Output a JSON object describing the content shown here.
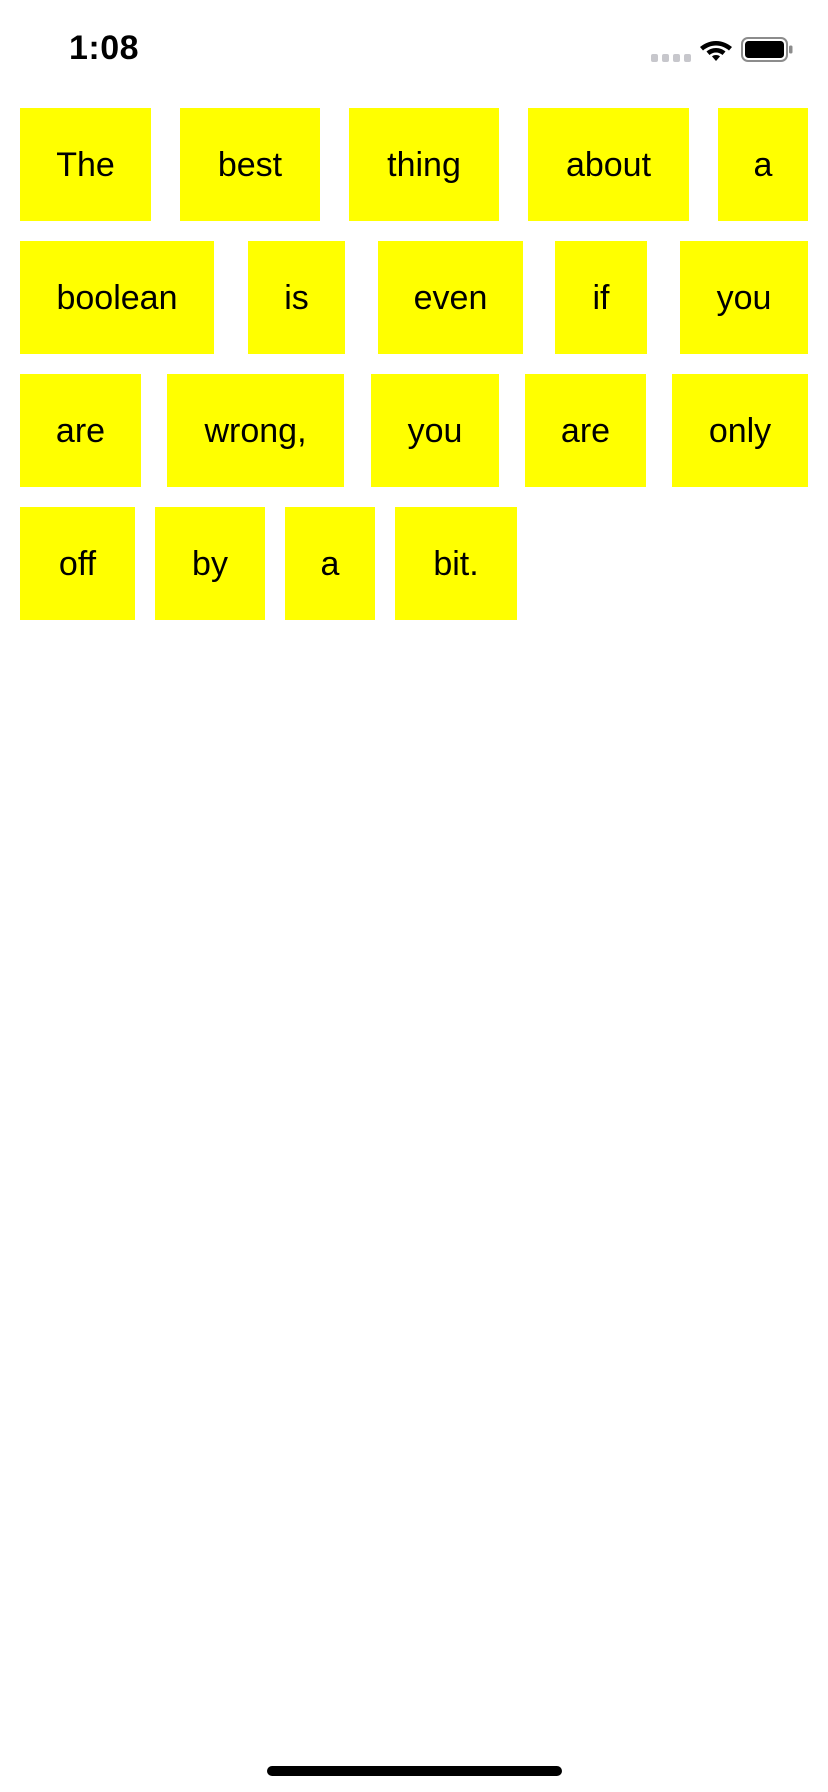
{
  "status_bar": {
    "time": "1:08",
    "icons": [
      "cellular-signal-icon",
      "wifi-icon",
      "battery-icon"
    ]
  },
  "colors": {
    "tile_background": "#ffff00",
    "text": "#000000",
    "page_background": "#ffffff"
  },
  "words": [
    "The",
    "best",
    "thing",
    "about",
    "a",
    "boolean",
    "is",
    "even",
    "if",
    "you",
    "are",
    "wrong,",
    "you",
    "are",
    "only",
    "off",
    "by",
    "a",
    "bit."
  ]
}
